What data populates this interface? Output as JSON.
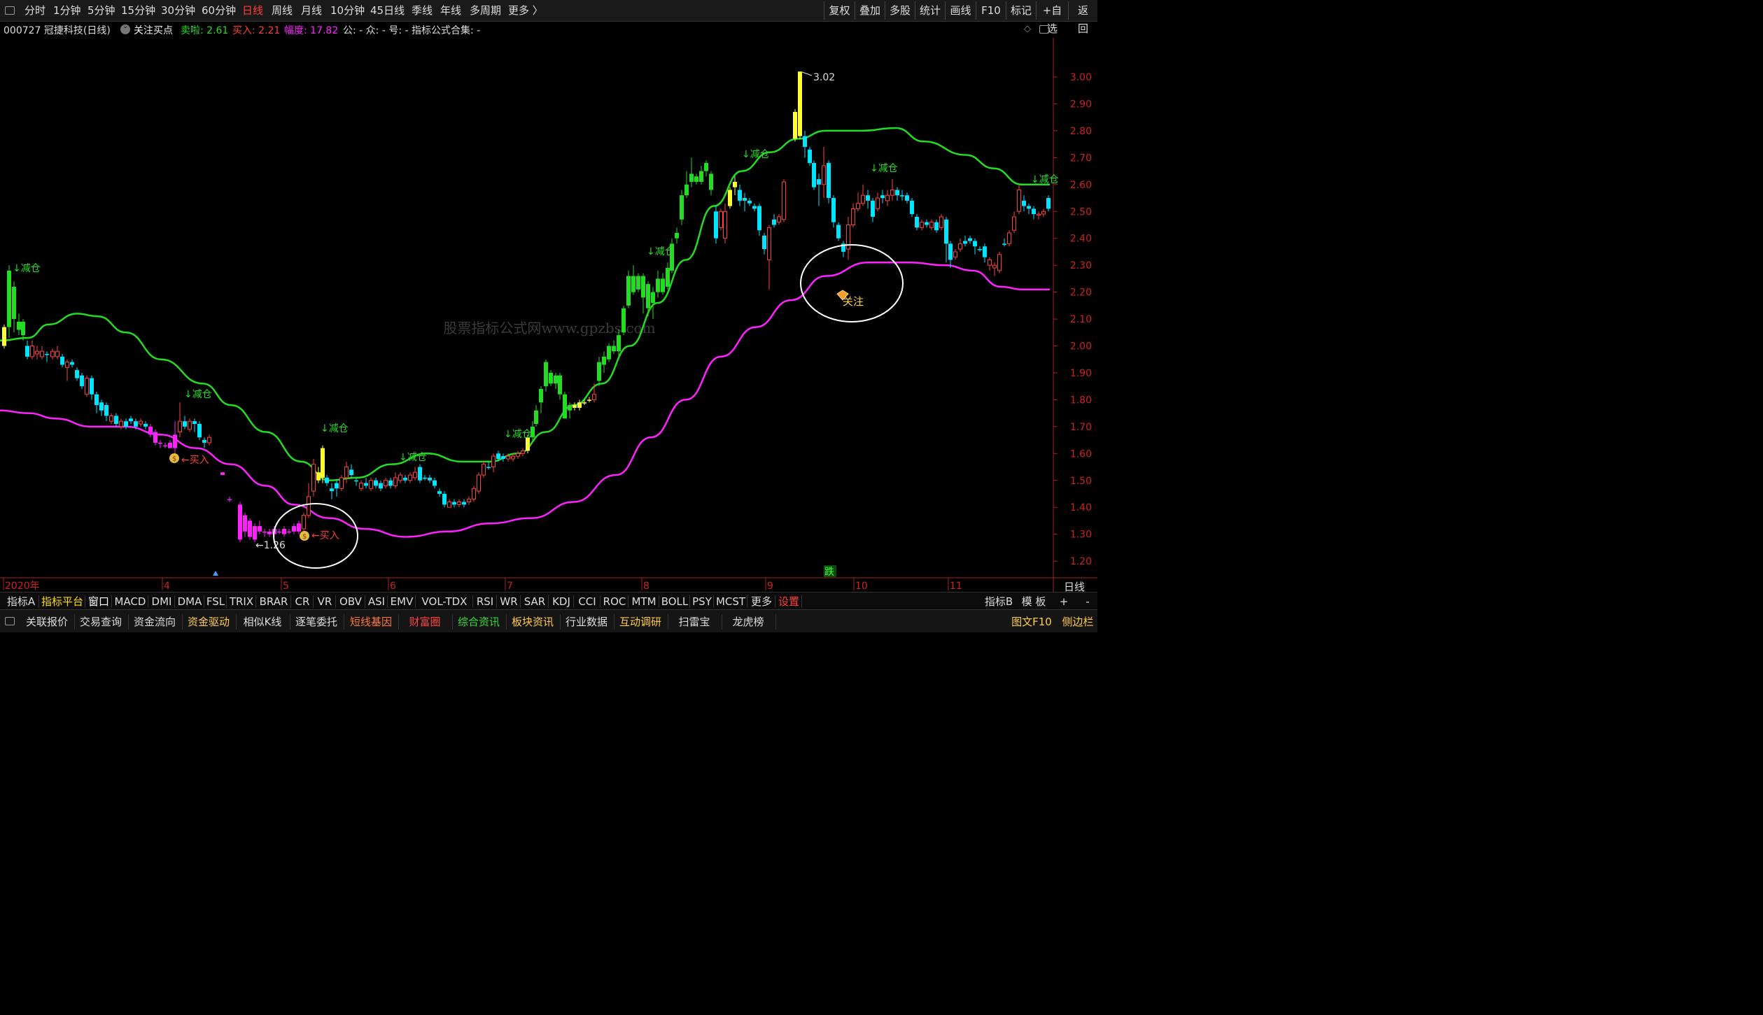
{
  "topbar": {
    "periods": [
      "分时",
      "1分钟",
      "5分钟",
      "15分钟",
      "30分钟",
      "60分钟",
      "日线",
      "周线",
      "月线",
      "10分钟",
      "45日线",
      "季线",
      "年线",
      "多周期",
      "更多 〉"
    ],
    "active_period": "日线",
    "right_buttons": [
      "复权",
      "叠加",
      "多股",
      "统计",
      "画线",
      "F10",
      "标记",
      "+自选",
      "返回"
    ]
  },
  "info": {
    "stock": "000727 冠捷科技(日线)",
    "indicator": "关注买点",
    "sell_label": "卖啦: 2.61",
    "buy_label": "买入: 2.21",
    "range_label": "幅度: 17.82",
    "misc": "公: -  众: -  号: -  指标公式合集: -"
  },
  "chart": {
    "y_ticks": [
      "3.00",
      "2.90",
      "2.80",
      "2.70",
      "2.60",
      "2.50",
      "2.40",
      "2.30",
      "2.20",
      "2.10",
      "2.00",
      "1.90",
      "1.80",
      "1.70",
      "1.60",
      "1.50",
      "1.40",
      "1.30",
      "1.20"
    ],
    "x_labels": [
      {
        "text": "2020年",
        "x": 5
      },
      {
        "text": "4",
        "x": 232
      },
      {
        "text": "5",
        "x": 402
      },
      {
        "text": "6",
        "x": 555
      },
      {
        "text": "7",
        "x": 722
      },
      {
        "text": "8",
        "x": 917
      },
      {
        "text": "9",
        "x": 1094
      },
      {
        "text": "10",
        "x": 1220
      },
      {
        "text": "11",
        "x": 1355
      }
    ],
    "period_label": "日线",
    "watermark": "股票指标公式网www.gpzbs.com",
    "max_label": "3.02",
    "min_label": "←1.26",
    "reduce_label": "↓减仓",
    "buy_label": "←买入",
    "focus_label": "关注",
    "fall_label": "跌",
    "colors": {
      "up_red": "#ff4040",
      "down_cyan": "#00e5ff",
      "green": "#22dd22",
      "yellow": "#ffff33",
      "magenta": "#ff22ff",
      "axis": "#aa2222"
    }
  },
  "tabs1": [
    "指标A",
    "指标平台",
    "窗口",
    "MACD",
    "DMI",
    "DMA",
    "FSL",
    "TRIX",
    "BRAR",
    "CR",
    "VR",
    "OBV",
    "ASI",
    "EMV",
    "VOL-TDX",
    "RSI",
    "WR",
    "SAR",
    "KDJ",
    "CCI",
    "ROC",
    "MTM",
    "BOLL",
    "PSY",
    "MCST",
    "更多",
    "设置"
  ],
  "tabs1_right": [
    "指标B",
    "模 板",
    "+",
    "-"
  ],
  "tabs2": [
    "关联报价",
    "交易查询",
    "资金流向",
    "资金驱动",
    "相似K线",
    "逐笔委托",
    "短线基因",
    "财富圈",
    "综合资讯",
    "板块资讯",
    "行业数据",
    "互动调研",
    "扫雷宝",
    "龙虎榜"
  ],
  "tabs2_right": [
    "图文F10",
    "侧边栏"
  ]
}
